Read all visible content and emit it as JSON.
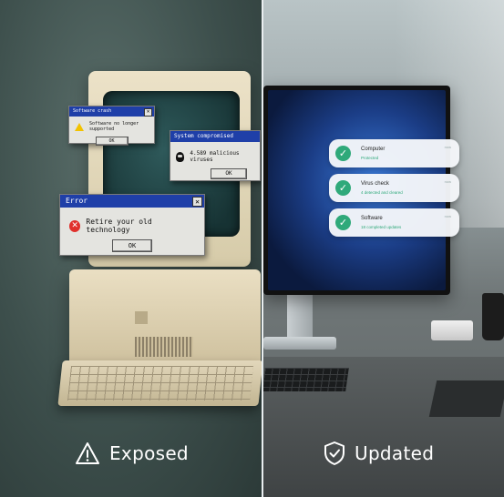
{
  "left_panel": {
    "dialogs": [
      {
        "title": "Software crash",
        "message": "Software no longer supported",
        "button": "OK",
        "icon": "warning-icon"
      },
      {
        "title": "System compromised",
        "message": "4.589 malicious viruses",
        "button": "OK",
        "icon": "skull-icon"
      },
      {
        "title": "Error",
        "message": "Retire your old technology",
        "button": "OK",
        "icon": "error-icon"
      }
    ],
    "caption": "Exposed",
    "caption_icon": "warning-outline-icon"
  },
  "right_panel": {
    "notifications": [
      {
        "title": "Computer",
        "subtitle": "Protected",
        "time": "now",
        "icon": "check-icon"
      },
      {
        "title": "Virus check",
        "subtitle": "4 detected and cleared",
        "time": "now",
        "icon": "check-icon"
      },
      {
        "title": "Software",
        "subtitle": "18 completed updates",
        "time": "now",
        "icon": "check-icon"
      }
    ],
    "caption": "Updated",
    "caption_icon": "shield-check-icon"
  },
  "colors": {
    "accent_green": "#2fa97a",
    "error_red": "#e0302c",
    "title_bar_blue": "#1f3fa8"
  }
}
